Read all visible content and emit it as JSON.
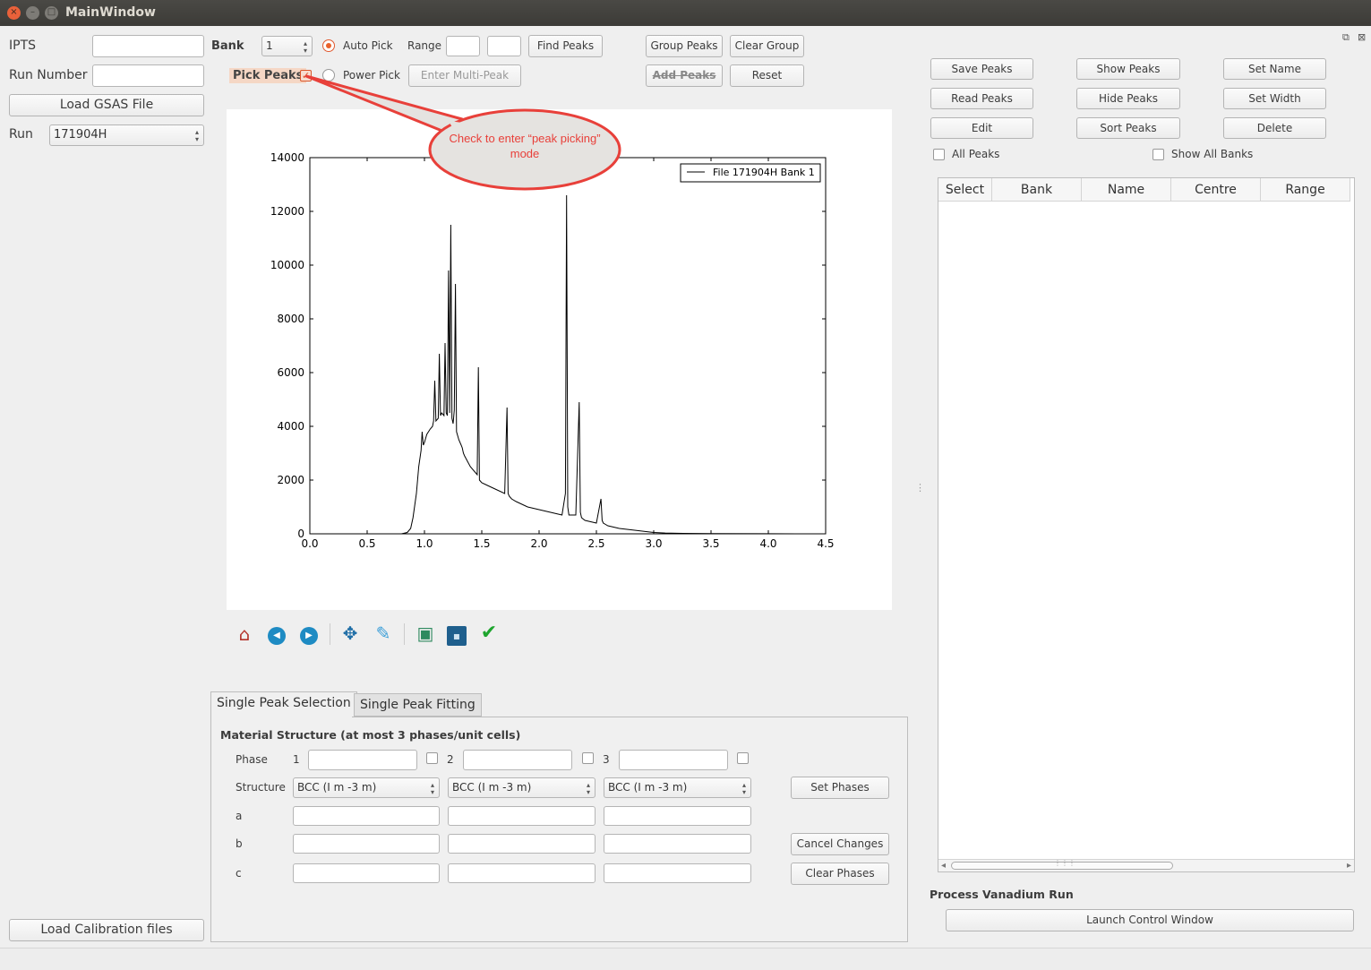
{
  "window": {
    "title": "MainWindow",
    "close_glyph": "×",
    "min_glyph": "–",
    "max_glyph": "□"
  },
  "left": {
    "ipts_label": "IPTS",
    "ipts_value": "",
    "run_number_label": "Run Number",
    "run_number_value": "",
    "load_gsas_label": "Load GSAS File",
    "run_label": "Run",
    "run_value": "171904H",
    "load_calibration_label": "Load Calibration files"
  },
  "toolbar": {
    "bank_label": "Bank",
    "bank_value": "1",
    "auto_pick_label": "Auto Pick",
    "power_pick_label": "Power Pick",
    "range_label": "Range",
    "range_min": "",
    "range_max": "",
    "find_peaks_label": "Find Peaks",
    "group_peaks_label": "Group Peaks",
    "clear_group_label": "Clear Group",
    "pick_peaks_label": "Pick Peaks",
    "pick_peaks_checked": true,
    "enter_multi_peak_label": "Enter Multi-Peak",
    "add_peaks_label": "Add Peaks",
    "reset_label": "Reset"
  },
  "callout": {
    "text_line1": "Check to enter “peak picking”",
    "text_line2": "mode"
  },
  "chart_data": {
    "type": "line",
    "title": "",
    "xlabel": "",
    "ylabel": "",
    "xlim": [
      0.0,
      4.5
    ],
    "ylim": [
      0,
      14000
    ],
    "x_ticks": [
      "0.0",
      "0.5",
      "1.0",
      "1.5",
      "2.0",
      "2.5",
      "3.0",
      "3.5",
      "4.0",
      "4.5"
    ],
    "y_ticks": [
      "0",
      "2000",
      "4000",
      "6000",
      "8000",
      "10000",
      "12000",
      "14000"
    ],
    "legend": "top-right",
    "series": [
      {
        "name": "File 171904H Bank 1",
        "color": "#000000",
        "x": [
          0.3,
          0.8,
          0.85,
          0.88,
          0.9,
          0.93,
          0.95,
          0.97,
          0.98,
          0.99,
          1.0,
          1.02,
          1.05,
          1.07,
          1.08,
          1.09,
          1.1,
          1.12,
          1.13,
          1.14,
          1.15,
          1.17,
          1.18,
          1.19,
          1.2,
          1.21,
          1.22,
          1.23,
          1.24,
          1.25,
          1.26,
          1.27,
          1.28,
          1.3,
          1.32,
          1.33,
          1.34,
          1.35,
          1.4,
          1.46,
          1.47,
          1.48,
          1.5,
          1.55,
          1.6,
          1.7,
          1.72,
          1.73,
          1.74,
          1.76,
          1.8,
          1.9,
          2.0,
          2.1,
          2.2,
          2.23,
          2.24,
          2.25,
          2.26,
          2.28,
          2.32,
          2.35,
          2.36,
          2.37,
          2.4,
          2.5,
          2.54,
          2.55,
          2.56,
          2.58,
          2.6,
          2.7,
          2.8,
          2.9,
          3.0,
          3.1,
          3.2,
          3.5,
          4.0,
          4.3
        ],
        "y": [
          0,
          0,
          50,
          200,
          600,
          1500,
          2500,
          3100,
          3800,
          3300,
          3400,
          3700,
          3900,
          4000,
          4200,
          5700,
          4200,
          4300,
          6700,
          4400,
          4500,
          4400,
          7100,
          4500,
          4400,
          9800,
          4500,
          11500,
          4300,
          4100,
          4600,
          9300,
          3800,
          3500,
          3300,
          3200,
          3000,
          2900,
          2500,
          2200,
          6200,
          2000,
          1900,
          1800,
          1700,
          1500,
          4700,
          1500,
          1400,
          1300,
          1200,
          1000,
          900,
          800,
          700,
          1500,
          12600,
          1000,
          700,
          700,
          700,
          4900,
          800,
          600,
          500,
          400,
          1300,
          500,
          400,
          350,
          300,
          200,
          150,
          100,
          50,
          30,
          20,
          10,
          5,
          0
        ]
      }
    ]
  },
  "plot_toolbar": {
    "home_glyph": "⌂",
    "back_glyph": "◀",
    "forward_glyph": "▶",
    "pan_glyph": "✥",
    "zoom_glyph": "✎",
    "subplots_glyph": "▣",
    "save_glyph": "▪",
    "check_glyph": "✔"
  },
  "tabs": {
    "single_peak_selection": "Single Peak Selection",
    "single_peak_fitting": "Single Peak Fitting"
  },
  "material": {
    "heading": "Material Structure (at most 3 phases/unit cells)",
    "phase_label": "Phase",
    "phase_numbers": [
      "1",
      "2",
      "3"
    ],
    "structure_label": "Structure",
    "structures": [
      "BCC (I m -3 m)",
      "BCC (I m -3 m)",
      "BCC (I m -3 m)"
    ],
    "a_label": "a",
    "b_label": "b",
    "c_label": "c",
    "set_phases_label": "Set Phases",
    "cancel_changes_label": "Cancel Changes",
    "clear_phases_label": "Clear Phases"
  },
  "right": {
    "save_peaks_label": "Save Peaks",
    "show_peaks_label": "Show Peaks",
    "set_name_label": "Set Name",
    "read_peaks_label": "Read Peaks",
    "hide_peaks_label": "Hide Peaks",
    "set_width_label": "Set Width",
    "edit_label": "Edit",
    "sort_peaks_label": "Sort Peaks",
    "delete_label": "Delete",
    "all_peaks_label": "All Peaks",
    "show_all_banks_label": "Show All Banks",
    "table_columns": [
      "Select",
      "Bank",
      "Name",
      "Centre",
      "Range"
    ],
    "vanadium_heading": "Process Vanadium Run",
    "launch_control_label": "Launch Control  Window",
    "scroll_grip": "⋮⋮⋮",
    "scroll_left": "◂",
    "scroll_right": "▸"
  },
  "spinner_arrows": "▴\n▾",
  "splitter_grip": "⋮",
  "dock_float_glyph": "⧉",
  "dock_close_glyph": "⊠"
}
